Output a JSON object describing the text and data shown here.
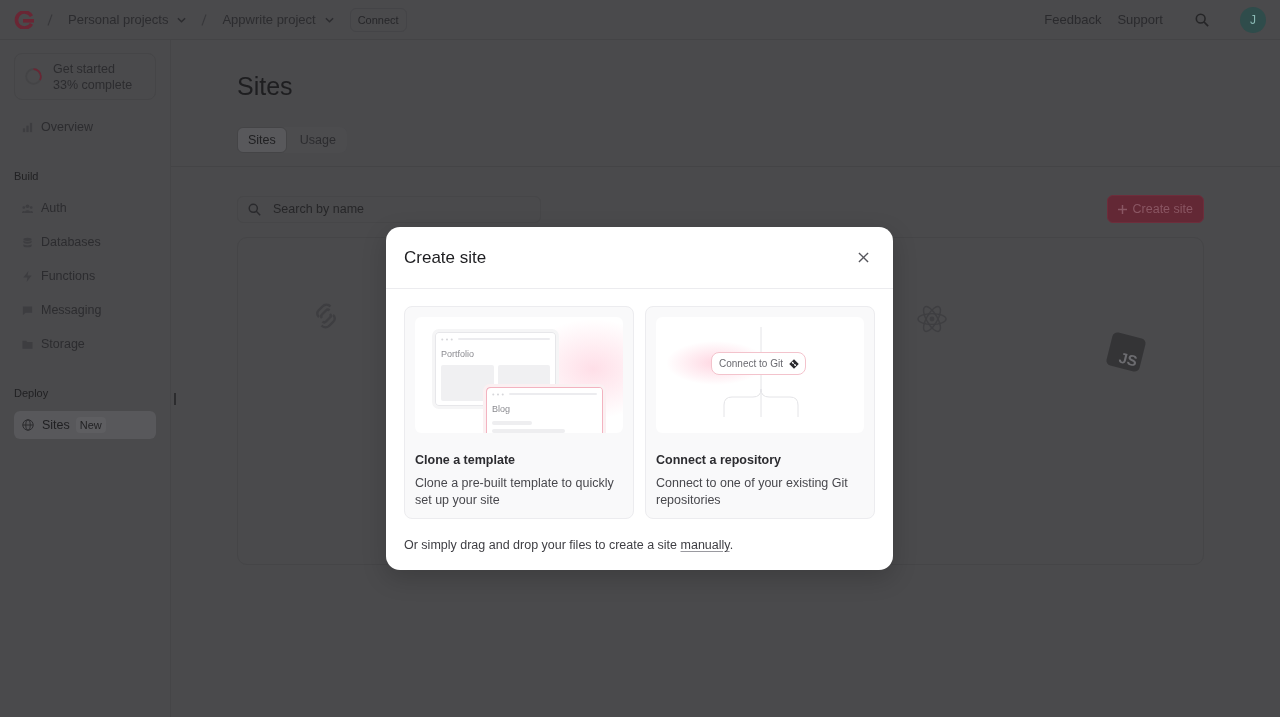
{
  "top_bar": {
    "breadcrumbs": [
      {
        "label": "Personal projects"
      },
      {
        "label": "Appwrite project"
      }
    ],
    "connect_button": "Connect",
    "links": [
      "Feedback",
      "Support"
    ],
    "avatar": "J"
  },
  "sidebar": {
    "onboarding": {
      "title": "Get started",
      "subtitle": "33% complete",
      "level": 0.33
    },
    "overview": {
      "label": "Overview",
      "selected": false
    },
    "sections": [
      {
        "heading": "Build",
        "items": [
          {
            "label": "Auth",
            "selected": false
          },
          {
            "label": "Databases",
            "selected": false
          },
          {
            "label": "Functions",
            "selected": false
          },
          {
            "label": "Messaging",
            "selected": false
          },
          {
            "label": "Storage",
            "selected": false
          }
        ]
      },
      {
        "heading": "Deploy",
        "items": [
          {
            "label": "Sites",
            "badge": "New",
            "selected": true
          }
        ]
      }
    ]
  },
  "page": {
    "title": "Sites",
    "tabs": [
      {
        "label": "Sites",
        "selected": true
      },
      {
        "label": "Usage",
        "selected": false
      }
    ],
    "search": {
      "placeholder": "Search by name"
    },
    "create_button": "Create site",
    "empty_state": {
      "logo_label": "JS"
    }
  },
  "modal": {
    "title": "Create site",
    "options": [
      {
        "kind": "template",
        "title": "Clone a template",
        "description": "Clone a pre-built template to quickly set up your site",
        "preview_labels": [
          "Portfolio",
          "Blog"
        ]
      },
      {
        "kind": "repository",
        "title": "Connect a repository",
        "description": "Connect to one of your existing Git repositories",
        "preview_labels": [
          "Connect to Git"
        ]
      }
    ],
    "footer": {
      "text": "Or simply drag and drop your files to create a site",
      "link": "manually",
      "end": "."
    }
  }
}
